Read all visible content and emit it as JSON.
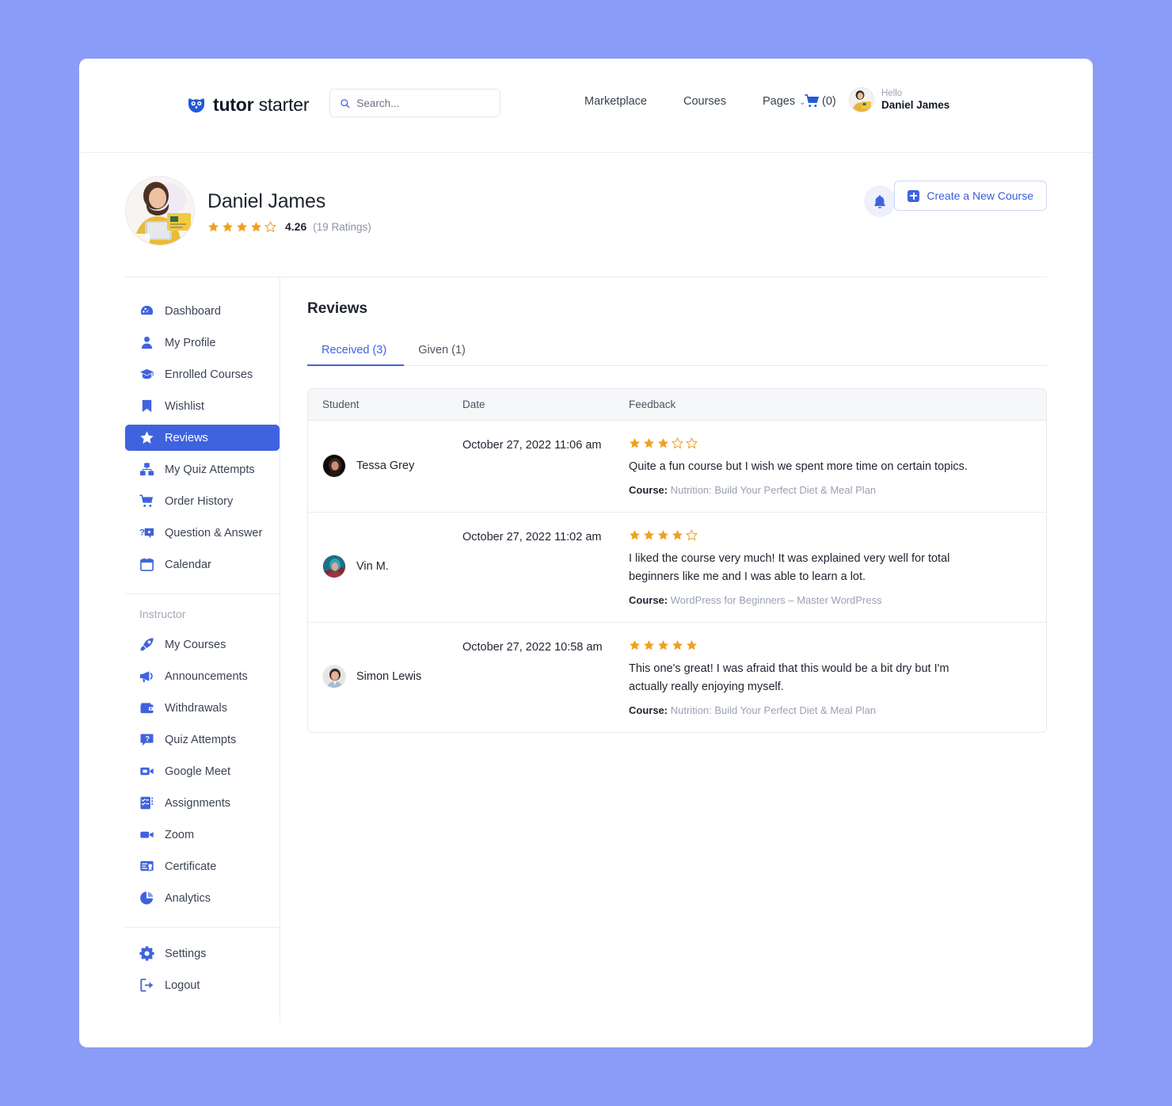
{
  "theme": {
    "page_bg": "#8a9cf7",
    "accent": "#3f63de",
    "star_color": "#f0a020",
    "star_empty": "#f0a020"
  },
  "topnav": {
    "logo_bold": "tutor",
    "logo_light": " starter",
    "search_placeholder": "Search...",
    "links": [
      {
        "label": "Marketplace",
        "has_chevron": false
      },
      {
        "label": "Courses",
        "has_chevron": false
      },
      {
        "label": "Pages",
        "has_chevron": true
      }
    ],
    "chevron": "⌄",
    "cart_count": "(0)",
    "user": {
      "greeting": "Hello",
      "name": "Daniel James"
    }
  },
  "profile": {
    "name": "Daniel James",
    "rating_value": "4.26",
    "rating_count": "(19 Ratings)",
    "stars_filled": 4,
    "stars_total": 5,
    "create_course_label": "Create a New Course"
  },
  "sidebar": {
    "groups": [
      {
        "title": null,
        "items": [
          {
            "label": "Dashboard",
            "icon": "dashboard-icon",
            "active": false
          },
          {
            "label": "My Profile",
            "icon": "user-icon",
            "active": false
          },
          {
            "label": "Enrolled Courses",
            "icon": "graduation-cap-icon",
            "active": false
          },
          {
            "label": "Wishlist",
            "icon": "bookmark-icon",
            "active": false
          },
          {
            "label": "Reviews",
            "icon": "star-icon",
            "active": true
          },
          {
            "label": "My Quiz Attempts",
            "icon": "quiz-blocks-icon",
            "active": false
          },
          {
            "label": "Order History",
            "icon": "cart-icon",
            "active": false
          },
          {
            "label": "Question & Answer",
            "icon": "question-answer-icon",
            "active": false
          },
          {
            "label": "Calendar",
            "icon": "calendar-icon",
            "active": false
          }
        ]
      },
      {
        "title": "Instructor",
        "items": [
          {
            "label": "My Courses",
            "icon": "rocket-icon",
            "active": false
          },
          {
            "label": "Announcements",
            "icon": "megaphone-icon",
            "active": false
          },
          {
            "label": "Withdrawals",
            "icon": "wallet-icon",
            "active": false
          },
          {
            "label": "Quiz Attempts",
            "icon": "question-bubble-icon",
            "active": false
          },
          {
            "label": "Google Meet",
            "icon": "video-camera-icon",
            "active": false
          },
          {
            "label": "Assignments",
            "icon": "checklist-icon",
            "active": false
          },
          {
            "label": "Zoom",
            "icon": "video-icon",
            "active": false
          },
          {
            "label": "Certificate",
            "icon": "certificate-icon",
            "active": false
          },
          {
            "label": "Analytics",
            "icon": "pie-chart-icon",
            "active": false
          }
        ]
      },
      {
        "title": null,
        "items": [
          {
            "label": "Settings",
            "icon": "gear-icon",
            "active": false
          },
          {
            "label": "Logout",
            "icon": "logout-icon",
            "active": false
          }
        ]
      }
    ]
  },
  "main": {
    "title": "Reviews",
    "tabs": [
      {
        "label": "Received (3)",
        "active": true
      },
      {
        "label": "Given (1)",
        "active": false
      }
    ],
    "table": {
      "headers": [
        "Student",
        "Date",
        "Feedback"
      ],
      "course_label": "Course:",
      "rows": [
        {
          "student": "Tessa Grey",
          "avatar_kind": "dark",
          "date": "October 27, 2022 11:06 am",
          "rating": 3,
          "feedback": "Quite a fun course but I wish we spent more time on certain topics.",
          "course": "Nutrition: Build Your Perfect Diet & Meal Plan"
        },
        {
          "student": "Vin M.",
          "avatar_kind": "teal",
          "date": "October 27, 2022 11:02 am",
          "rating": 4,
          "feedback": "I liked the course very much! It was explained very well for total beginners like me and I was able to learn a lot.",
          "course": "WordPress for Beginners – Master WordPress"
        },
        {
          "student": "Simon Lewis",
          "avatar_kind": "light",
          "date": "October 27, 2022 10:58 am",
          "rating": 5,
          "feedback": "This one's great! I was afraid that this would be a bit dry but I'm actually really enjoying myself.",
          "course": "Nutrition: Build Your Perfect Diet & Meal Plan"
        }
      ]
    }
  }
}
